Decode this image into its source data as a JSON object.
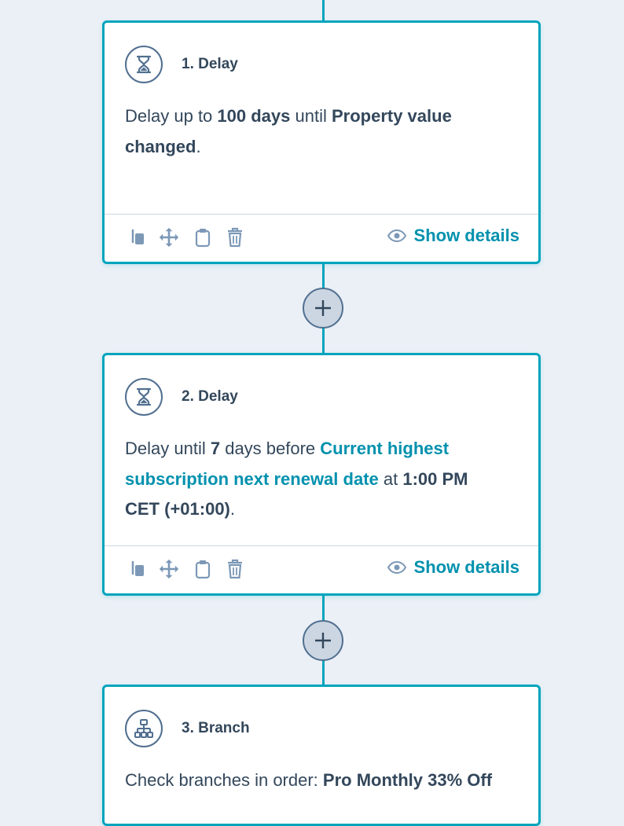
{
  "steps": [
    {
      "title": "1. Delay",
      "icon": "hourglass-icon",
      "body": [
        {
          "t": "Delay up to ",
          "s": "n"
        },
        {
          "t": "100 days",
          "s": "b"
        },
        {
          "t": " until ",
          "s": "n"
        },
        {
          "t": "Property value changed",
          "s": "b"
        },
        {
          "t": ".",
          "s": "n"
        }
      ],
      "footer": {
        "show_details": "Show details"
      }
    },
    {
      "title": "2. Delay",
      "icon": "hourglass-icon",
      "body": [
        {
          "t": "Delay until ",
          "s": "n"
        },
        {
          "t": "7",
          "s": "b"
        },
        {
          "t": " days before ",
          "s": "n"
        },
        {
          "t": "Current highest subscription next renewal date",
          "s": "l"
        },
        {
          "t": " at ",
          "s": "n"
        },
        {
          "t": "1:00 PM CET (+01:00)",
          "s": "b"
        },
        {
          "t": ".",
          "s": "n"
        }
      ],
      "footer": {
        "show_details": "Show details"
      }
    },
    {
      "title": "3. Branch",
      "icon": "branch-icon",
      "body": [
        {
          "t": "Check branches in order: ",
          "s": "n"
        },
        {
          "t": "Pro Monthly 33% Off",
          "s": "b"
        }
      ]
    }
  ],
  "colors": {
    "accent": "#00a4bd",
    "link": "#0091ae",
    "text": "#33475b",
    "icon": "#516f90",
    "canvas": "#eaf0f6"
  },
  "toolbar_icons": [
    "copy-icon",
    "move-icon",
    "clipboard-icon",
    "delete-icon"
  ],
  "show_details_icon": "eye-icon",
  "add_icon": "plus-icon"
}
